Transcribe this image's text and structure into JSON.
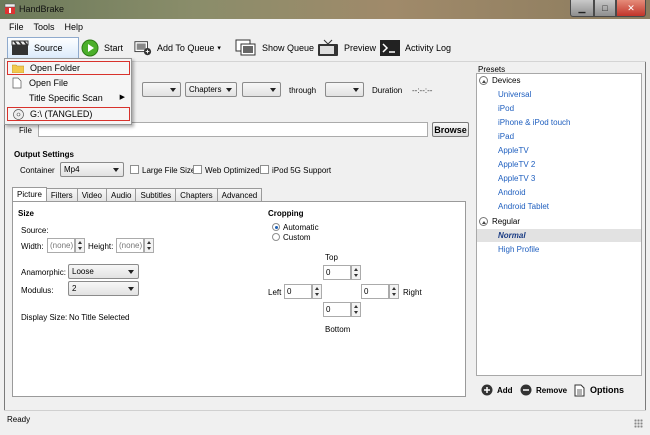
{
  "window": {
    "title": "HandBrake"
  },
  "menu": [
    "File",
    "Tools",
    "Help"
  ],
  "toolbar": {
    "source": "Source",
    "start": "Start",
    "add_to_queue": "Add To Queue",
    "add_to_queue_arrow": "▾",
    "show_queue": "Show Queue",
    "preview": "Preview",
    "activity_log": "Activity Log"
  },
  "source_menu": {
    "open_folder": "Open Folder",
    "open_file": "Open File",
    "title_specific_scan": "Title Specific Scan",
    "drive": "G:\\ (TANGLED)"
  },
  "source_row": {
    "chapters": "Chapters",
    "through": "through",
    "duration_label": "Duration",
    "duration_value": "--:--:--"
  },
  "destination": {
    "file_label": "File",
    "browse": "Browse"
  },
  "output": {
    "title": "Output Settings",
    "container_label": "Container",
    "container_value": "Mp4",
    "large_file": "Large File Size",
    "web_optimized": "Web Optimized",
    "ipod_support": "iPod 5G Support"
  },
  "tabs": [
    "Picture",
    "Filters",
    "Video",
    "Audio",
    "Subtitles",
    "Chapters",
    "Advanced"
  ],
  "picture": {
    "size_title": "Size",
    "source_label": "Source:",
    "width_label": "Width:",
    "width_value": "(none)",
    "height_label": "Height:",
    "height_value": "(none)",
    "anamorphic_label": "Anamorphic:",
    "anamorphic_value": "Loose",
    "modulus_label": "Modulus:",
    "modulus_value": "2",
    "display_size_label": "Display Size:",
    "display_size_value": "No Title Selected",
    "cropping_title": "Cropping",
    "automatic": "Automatic",
    "custom": "Custom",
    "top": "Top",
    "bottom": "Bottom",
    "left": "Left",
    "right": "Right",
    "crop_top": "0",
    "crop_bottom": "0",
    "crop_left": "0",
    "crop_right": "0"
  },
  "presets": {
    "title": "Presets",
    "devices_label": "Devices",
    "devices": [
      "Universal",
      "iPod",
      "iPhone & iPod touch",
      "iPad",
      "AppleTV",
      "AppleTV 2",
      "AppleTV 3",
      "Android",
      "Android Tablet"
    ],
    "regular_label": "Regular",
    "regular": [
      "Normal",
      "High Profile"
    ],
    "add": "Add",
    "remove": "Remove",
    "options": "Options"
  },
  "status": "Ready",
  "colors": {
    "highlight_border": "#d8322c",
    "preset_link": "#1f5fbf"
  }
}
